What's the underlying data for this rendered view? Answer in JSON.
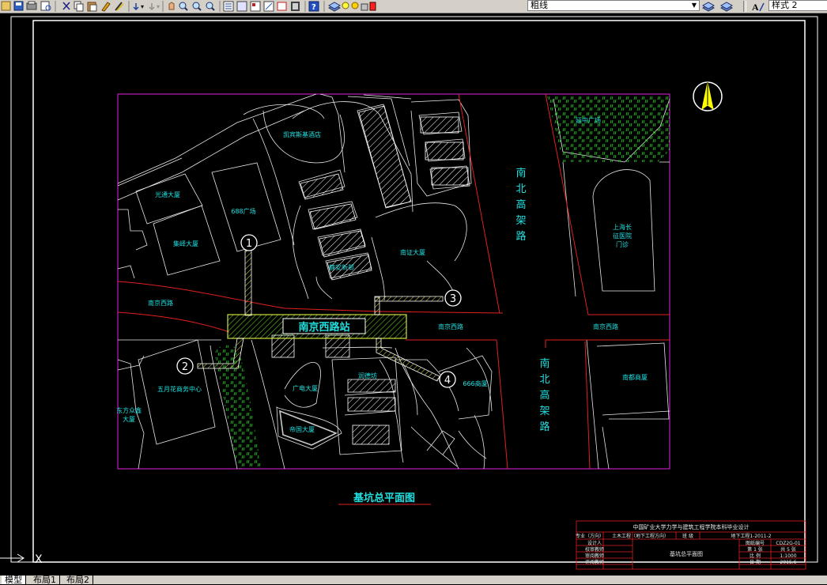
{
  "toolbar": {
    "linetype_value": "粗线",
    "style_value": "样式 2"
  },
  "drawing": {
    "title": "基坑总平面图",
    "station": "南京西路站",
    "roads": {
      "nanjing_west_1": "南京西路",
      "nanjing_west_2": "南京西路",
      "nanjing_west_3": "南京西路",
      "elevated_north": [
        "南",
        "北",
        "高",
        "架",
        "路"
      ],
      "elevated_south": [
        "南",
        "北",
        "高",
        "架",
        "路"
      ]
    },
    "buildings": {
      "kaibin": "凯宾斯基酒店",
      "guangtong": "光通大厦",
      "plaza688": "688广场",
      "jiefu": "集峄大厦",
      "jingan": "静安新邨",
      "nanzheng": "南证大厦",
      "yanzhong": "延中广场",
      "hospital": [
        "上海长",
        "征医院",
        "门诊"
      ],
      "wuyuehua": "五月花商务中心",
      "dongfang": [
        "东方众鑫",
        "大厦"
      ],
      "guangdian": "广电大厦",
      "runbo": "润德坊",
      "bldg666": "666商厦",
      "didu": "帝国大厦",
      "nandu": "南都商厦"
    },
    "entrances": [
      "1",
      "2",
      "3",
      "4"
    ]
  },
  "title_block": {
    "header": "中国矿业大学力学与建筑工程学院本科毕业设计",
    "row1_label": "专业（方向）",
    "row1_value": "土木工程（地下工程方向）",
    "row1_cls": "班 级",
    "row1_cls_value": "地下工程1-2011-2",
    "designer": "设计人",
    "proofreader": "校审教师",
    "approver": "审阅教师",
    "reviewer": "评阅教师",
    "drawing_name": "基坑总平面图",
    "drawing_no_label": "图纸编号",
    "drawing_no": "CDZ2G-01",
    "sheet_label": "第 1 张",
    "sheet_total": "共 5 张",
    "scale_label": "比 例",
    "scale": "1:1000",
    "date_label": "日 期",
    "date": "2015.6"
  },
  "tabs": [
    "模型",
    "布局1",
    "布局2"
  ],
  "ucs_label": "X"
}
